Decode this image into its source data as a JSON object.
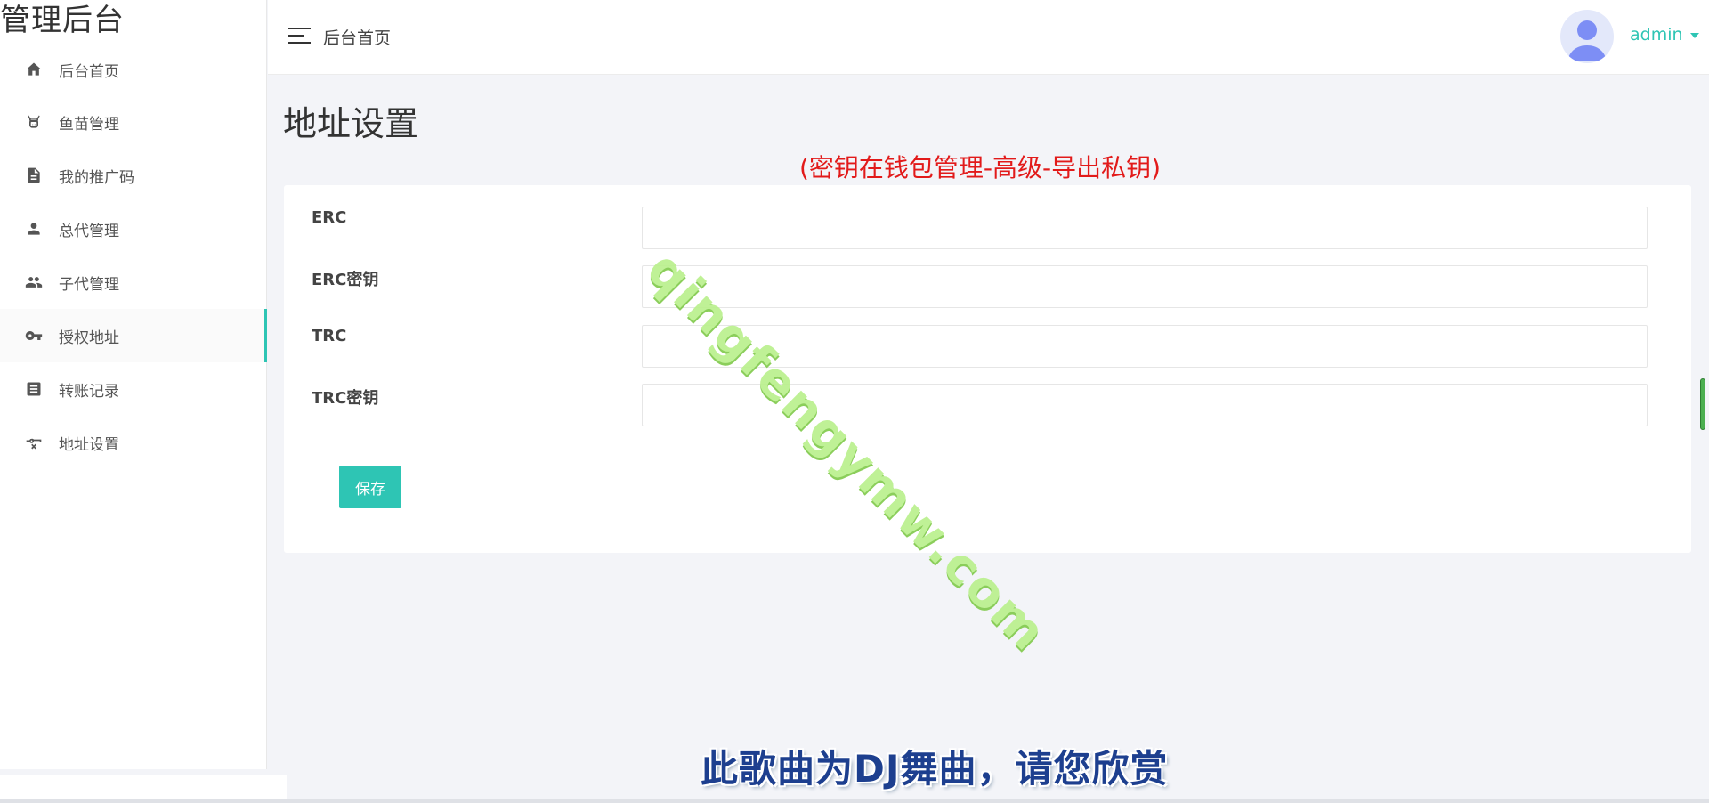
{
  "brand": "管理后台",
  "sidebar": {
    "items": [
      {
        "label": "后台首页",
        "icon": "home-icon"
      },
      {
        "label": "鱼苗管理",
        "icon": "cow-icon"
      },
      {
        "label": "我的推广码",
        "icon": "document-icon"
      },
      {
        "label": "总代管理",
        "icon": "person-icon"
      },
      {
        "label": "子代管理",
        "icon": "people-icon"
      },
      {
        "label": "授权地址",
        "icon": "key-icon"
      },
      {
        "label": "转账记录",
        "icon": "record-icon"
      },
      {
        "label": "地址设置",
        "icon": "key-off-icon"
      }
    ],
    "active_index": 5
  },
  "header": {
    "breadcrumb": "后台首页",
    "username": "admin"
  },
  "main": {
    "title": "地址设置",
    "notice": "(密钥在钱包管理-高级-导出私钥)",
    "fields": [
      {
        "label": "ERC",
        "value": ""
      },
      {
        "label": "ERC密钥",
        "value": ""
      },
      {
        "label": "TRC",
        "value": ""
      },
      {
        "label": "TRC密钥",
        "value": ""
      }
    ],
    "save_label": "保存"
  },
  "overlay": {
    "watermark": "qingfengymw.com",
    "subtitle": "此歌曲为DJ舞曲，请您欣赏"
  },
  "colors": {
    "accent": "#2ec5b4",
    "notice": "#e21a1a",
    "background": "#f3f4f8"
  }
}
